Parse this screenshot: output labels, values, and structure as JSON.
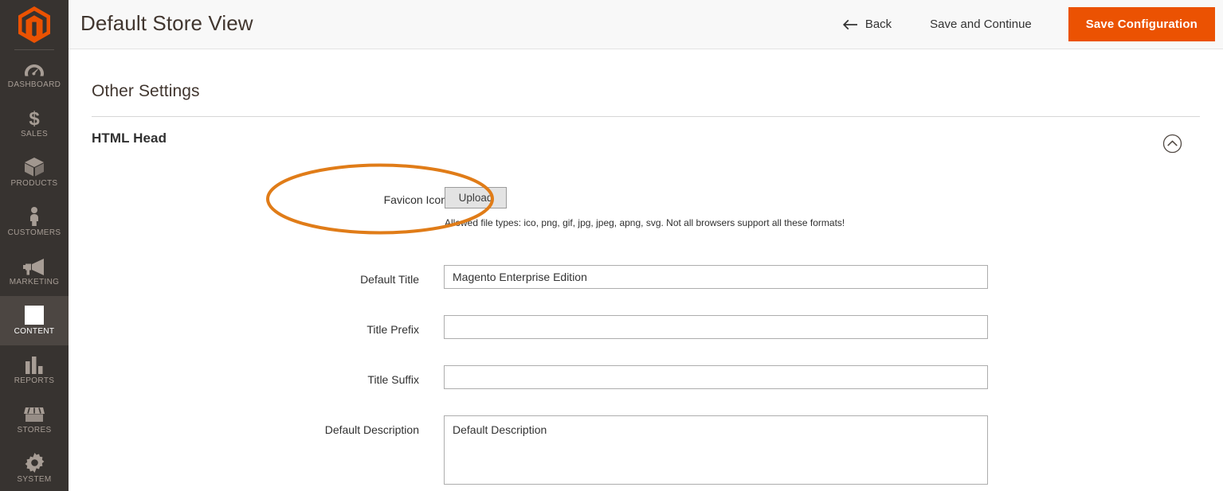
{
  "sidebar": {
    "logo_name": "magento-logo",
    "items": [
      {
        "label": "DASHBOARD",
        "icon": "dashboard-gauge-icon",
        "active": false
      },
      {
        "label": "SALES",
        "icon": "dollar-sign-icon",
        "active": false
      },
      {
        "label": "PRODUCTS",
        "icon": "box-icon",
        "active": false
      },
      {
        "label": "CUSTOMERS",
        "icon": "person-icon",
        "active": false
      },
      {
        "label": "MARKETING",
        "icon": "megaphone-icon",
        "active": false
      },
      {
        "label": "CONTENT",
        "icon": "layout-panel-icon",
        "active": true
      },
      {
        "label": "REPORTS",
        "icon": "bar-chart-icon",
        "active": false
      },
      {
        "label": "STORES",
        "icon": "storefront-icon",
        "active": false
      },
      {
        "label": "SYSTEM",
        "icon": "gear-icon",
        "active": false
      }
    ]
  },
  "header": {
    "title": "Default Store View",
    "back_label": "Back",
    "back_icon": "arrow-left-icon",
    "save_continue_label": "Save and Continue",
    "save_config_label": "Save Configuration",
    "save_config_color": "#eb5202"
  },
  "content": {
    "other_settings_heading": "Other Settings",
    "section": {
      "title": "HTML Head",
      "collapse_icon": "chevron-up-circle-icon",
      "expanded": true
    },
    "fields": {
      "favicon": {
        "label": "Favicon Icon",
        "upload_label": "Upload",
        "note": "Allowed file types: ico, png, gif, jpg, jpeg, apng, svg. Not all browsers support all these formats!"
      },
      "default_title": {
        "label": "Default Title",
        "value": "Magento Enterprise Edition",
        "placeholder": ""
      },
      "title_prefix": {
        "label": "Title Prefix",
        "value": "",
        "placeholder": ""
      },
      "title_suffix": {
        "label": "Title Suffix",
        "value": "",
        "placeholder": ""
      },
      "default_description": {
        "label": "Default Description",
        "value": "Default Description",
        "placeholder": ""
      }
    }
  },
  "annotation": {
    "shape": "ellipse",
    "target": "favicon-icon-field",
    "color": "#e07c18",
    "stroke_width": 4
  }
}
